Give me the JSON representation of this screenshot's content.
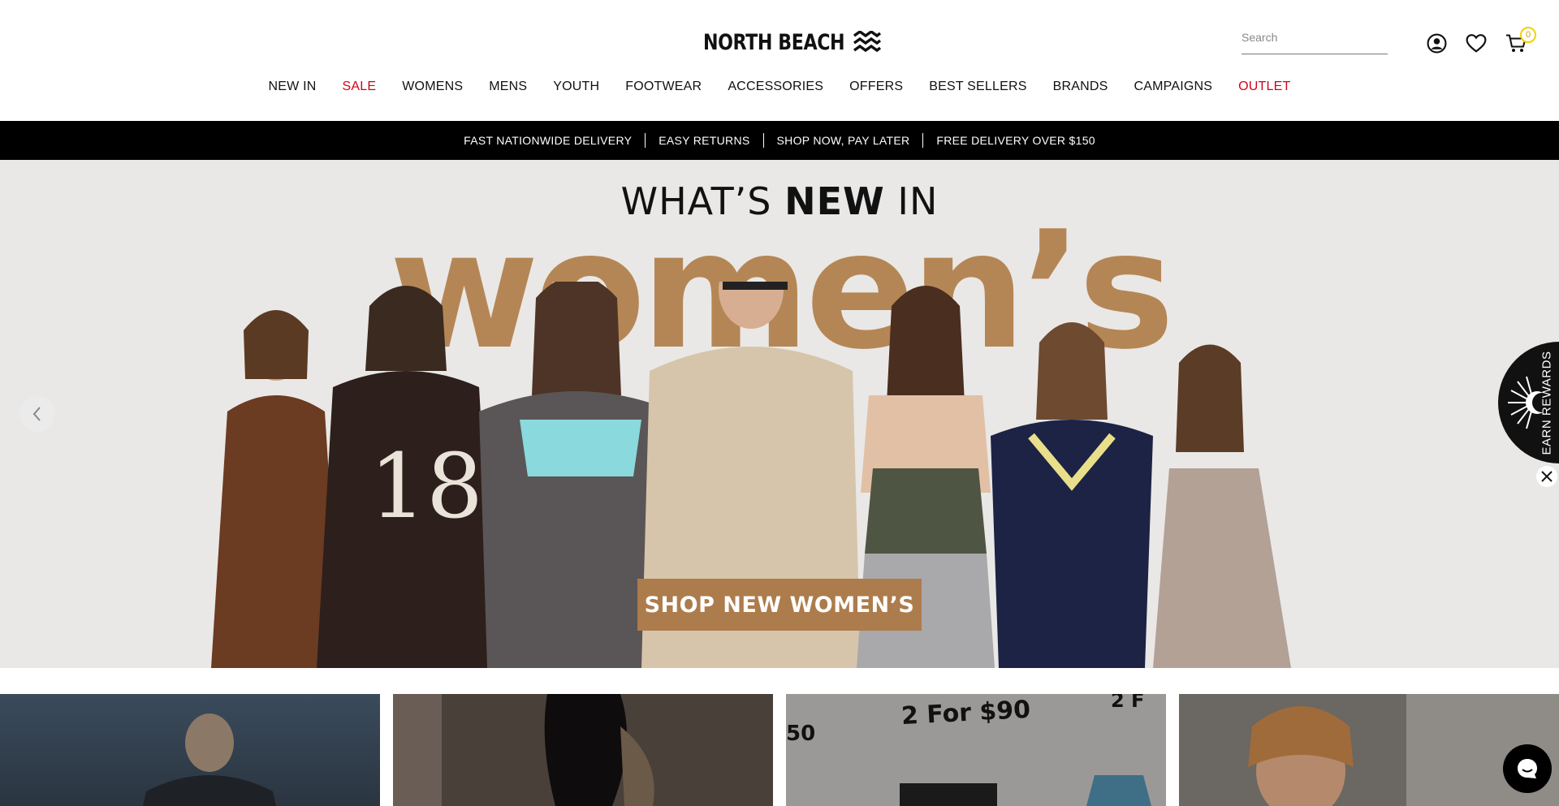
{
  "brand": {
    "name": "NORTH BEACH"
  },
  "search": {
    "placeholder": "Search"
  },
  "cart": {
    "count": "0"
  },
  "nav": [
    {
      "label": "NEW IN",
      "highlight": false
    },
    {
      "label": "SALE",
      "highlight": true
    },
    {
      "label": "WOMENS",
      "highlight": false
    },
    {
      "label": "MENS",
      "highlight": false
    },
    {
      "label": "YOUTH",
      "highlight": false
    },
    {
      "label": "FOOTWEAR",
      "highlight": false
    },
    {
      "label": "ACCESSORIES",
      "highlight": false
    },
    {
      "label": "OFFERS",
      "highlight": false
    },
    {
      "label": "BEST SELLERS",
      "highlight": false
    },
    {
      "label": "BRANDS",
      "highlight": false
    },
    {
      "label": "CAMPAIGNS",
      "highlight": false
    },
    {
      "label": "OUTLET",
      "highlight": true
    }
  ],
  "announcements": [
    "FAST NATIONWIDE DELIVERY",
    "EASY RETURNS",
    "SHOP NOW, PAY LATER",
    "FREE DELIVERY OVER $150"
  ],
  "hero": {
    "title_prefix": "WHAT’S ",
    "title_bold": "NEW",
    "title_suffix": " IN",
    "big_word": "women’s",
    "cta": "SHOP NEW WOMEN’S"
  },
  "rewards": {
    "label": "EARN REWARDS"
  },
  "tiles": {
    "promo_title": "2 For $90",
    "promo_left": "50",
    "promo_right": "2 F"
  },
  "colors": {
    "accent_red": "#d0021b",
    "hero_brown": "#b58655",
    "cta_brown": "#ad7c4c",
    "cart_badge": "#f2d200"
  },
  "icons": [
    "account-icon",
    "heart-icon",
    "cart-icon",
    "chevron-left-icon",
    "close-icon",
    "chat-icon",
    "waves-logo-icon"
  ]
}
